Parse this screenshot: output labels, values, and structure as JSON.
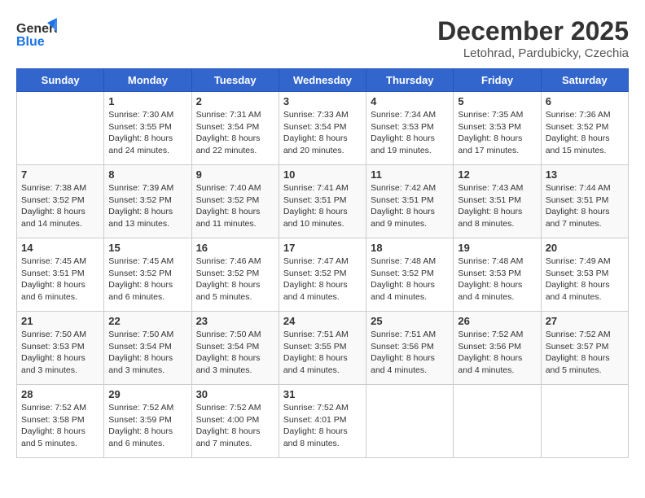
{
  "header": {
    "logo_general": "General",
    "logo_blue": "Blue",
    "month_title": "December 2025",
    "location": "Letohrad, Pardubicky, Czechia"
  },
  "days_of_week": [
    "Sunday",
    "Monday",
    "Tuesday",
    "Wednesday",
    "Thursday",
    "Friday",
    "Saturday"
  ],
  "weeks": [
    [
      {
        "day": "",
        "info": ""
      },
      {
        "day": "1",
        "info": "Sunrise: 7:30 AM\nSunset: 3:55 PM\nDaylight: 8 hours\nand 24 minutes."
      },
      {
        "day": "2",
        "info": "Sunrise: 7:31 AM\nSunset: 3:54 PM\nDaylight: 8 hours\nand 22 minutes."
      },
      {
        "day": "3",
        "info": "Sunrise: 7:33 AM\nSunset: 3:54 PM\nDaylight: 8 hours\nand 20 minutes."
      },
      {
        "day": "4",
        "info": "Sunrise: 7:34 AM\nSunset: 3:53 PM\nDaylight: 8 hours\nand 19 minutes."
      },
      {
        "day": "5",
        "info": "Sunrise: 7:35 AM\nSunset: 3:53 PM\nDaylight: 8 hours\nand 17 minutes."
      },
      {
        "day": "6",
        "info": "Sunrise: 7:36 AM\nSunset: 3:52 PM\nDaylight: 8 hours\nand 15 minutes."
      }
    ],
    [
      {
        "day": "7",
        "info": "Sunrise: 7:38 AM\nSunset: 3:52 PM\nDaylight: 8 hours\nand 14 minutes."
      },
      {
        "day": "8",
        "info": "Sunrise: 7:39 AM\nSunset: 3:52 PM\nDaylight: 8 hours\nand 13 minutes."
      },
      {
        "day": "9",
        "info": "Sunrise: 7:40 AM\nSunset: 3:52 PM\nDaylight: 8 hours\nand 11 minutes."
      },
      {
        "day": "10",
        "info": "Sunrise: 7:41 AM\nSunset: 3:51 PM\nDaylight: 8 hours\nand 10 minutes."
      },
      {
        "day": "11",
        "info": "Sunrise: 7:42 AM\nSunset: 3:51 PM\nDaylight: 8 hours\nand 9 minutes."
      },
      {
        "day": "12",
        "info": "Sunrise: 7:43 AM\nSunset: 3:51 PM\nDaylight: 8 hours\nand 8 minutes."
      },
      {
        "day": "13",
        "info": "Sunrise: 7:44 AM\nSunset: 3:51 PM\nDaylight: 8 hours\nand 7 minutes."
      }
    ],
    [
      {
        "day": "14",
        "info": "Sunrise: 7:45 AM\nSunset: 3:51 PM\nDaylight: 8 hours\nand 6 minutes."
      },
      {
        "day": "15",
        "info": "Sunrise: 7:45 AM\nSunset: 3:52 PM\nDaylight: 8 hours\nand 6 minutes."
      },
      {
        "day": "16",
        "info": "Sunrise: 7:46 AM\nSunset: 3:52 PM\nDaylight: 8 hours\nand 5 minutes."
      },
      {
        "day": "17",
        "info": "Sunrise: 7:47 AM\nSunset: 3:52 PM\nDaylight: 8 hours\nand 4 minutes."
      },
      {
        "day": "18",
        "info": "Sunrise: 7:48 AM\nSunset: 3:52 PM\nDaylight: 8 hours\nand 4 minutes."
      },
      {
        "day": "19",
        "info": "Sunrise: 7:48 AM\nSunset: 3:53 PM\nDaylight: 8 hours\nand 4 minutes."
      },
      {
        "day": "20",
        "info": "Sunrise: 7:49 AM\nSunset: 3:53 PM\nDaylight: 8 hours\nand 4 minutes."
      }
    ],
    [
      {
        "day": "21",
        "info": "Sunrise: 7:50 AM\nSunset: 3:53 PM\nDaylight: 8 hours\nand 3 minutes."
      },
      {
        "day": "22",
        "info": "Sunrise: 7:50 AM\nSunset: 3:54 PM\nDaylight: 8 hours\nand 3 minutes."
      },
      {
        "day": "23",
        "info": "Sunrise: 7:50 AM\nSunset: 3:54 PM\nDaylight: 8 hours\nand 3 minutes."
      },
      {
        "day": "24",
        "info": "Sunrise: 7:51 AM\nSunset: 3:55 PM\nDaylight: 8 hours\nand 4 minutes."
      },
      {
        "day": "25",
        "info": "Sunrise: 7:51 AM\nSunset: 3:56 PM\nDaylight: 8 hours\nand 4 minutes."
      },
      {
        "day": "26",
        "info": "Sunrise: 7:52 AM\nSunset: 3:56 PM\nDaylight: 8 hours\nand 4 minutes."
      },
      {
        "day": "27",
        "info": "Sunrise: 7:52 AM\nSunset: 3:57 PM\nDaylight: 8 hours\nand 5 minutes."
      }
    ],
    [
      {
        "day": "28",
        "info": "Sunrise: 7:52 AM\nSunset: 3:58 PM\nDaylight: 8 hours\nand 5 minutes."
      },
      {
        "day": "29",
        "info": "Sunrise: 7:52 AM\nSunset: 3:59 PM\nDaylight: 8 hours\nand 6 minutes."
      },
      {
        "day": "30",
        "info": "Sunrise: 7:52 AM\nSunset: 4:00 PM\nDaylight: 8 hours\nand 7 minutes."
      },
      {
        "day": "31",
        "info": "Sunrise: 7:52 AM\nSunset: 4:01 PM\nDaylight: 8 hours\nand 8 minutes."
      },
      {
        "day": "",
        "info": ""
      },
      {
        "day": "",
        "info": ""
      },
      {
        "day": "",
        "info": ""
      }
    ]
  ]
}
